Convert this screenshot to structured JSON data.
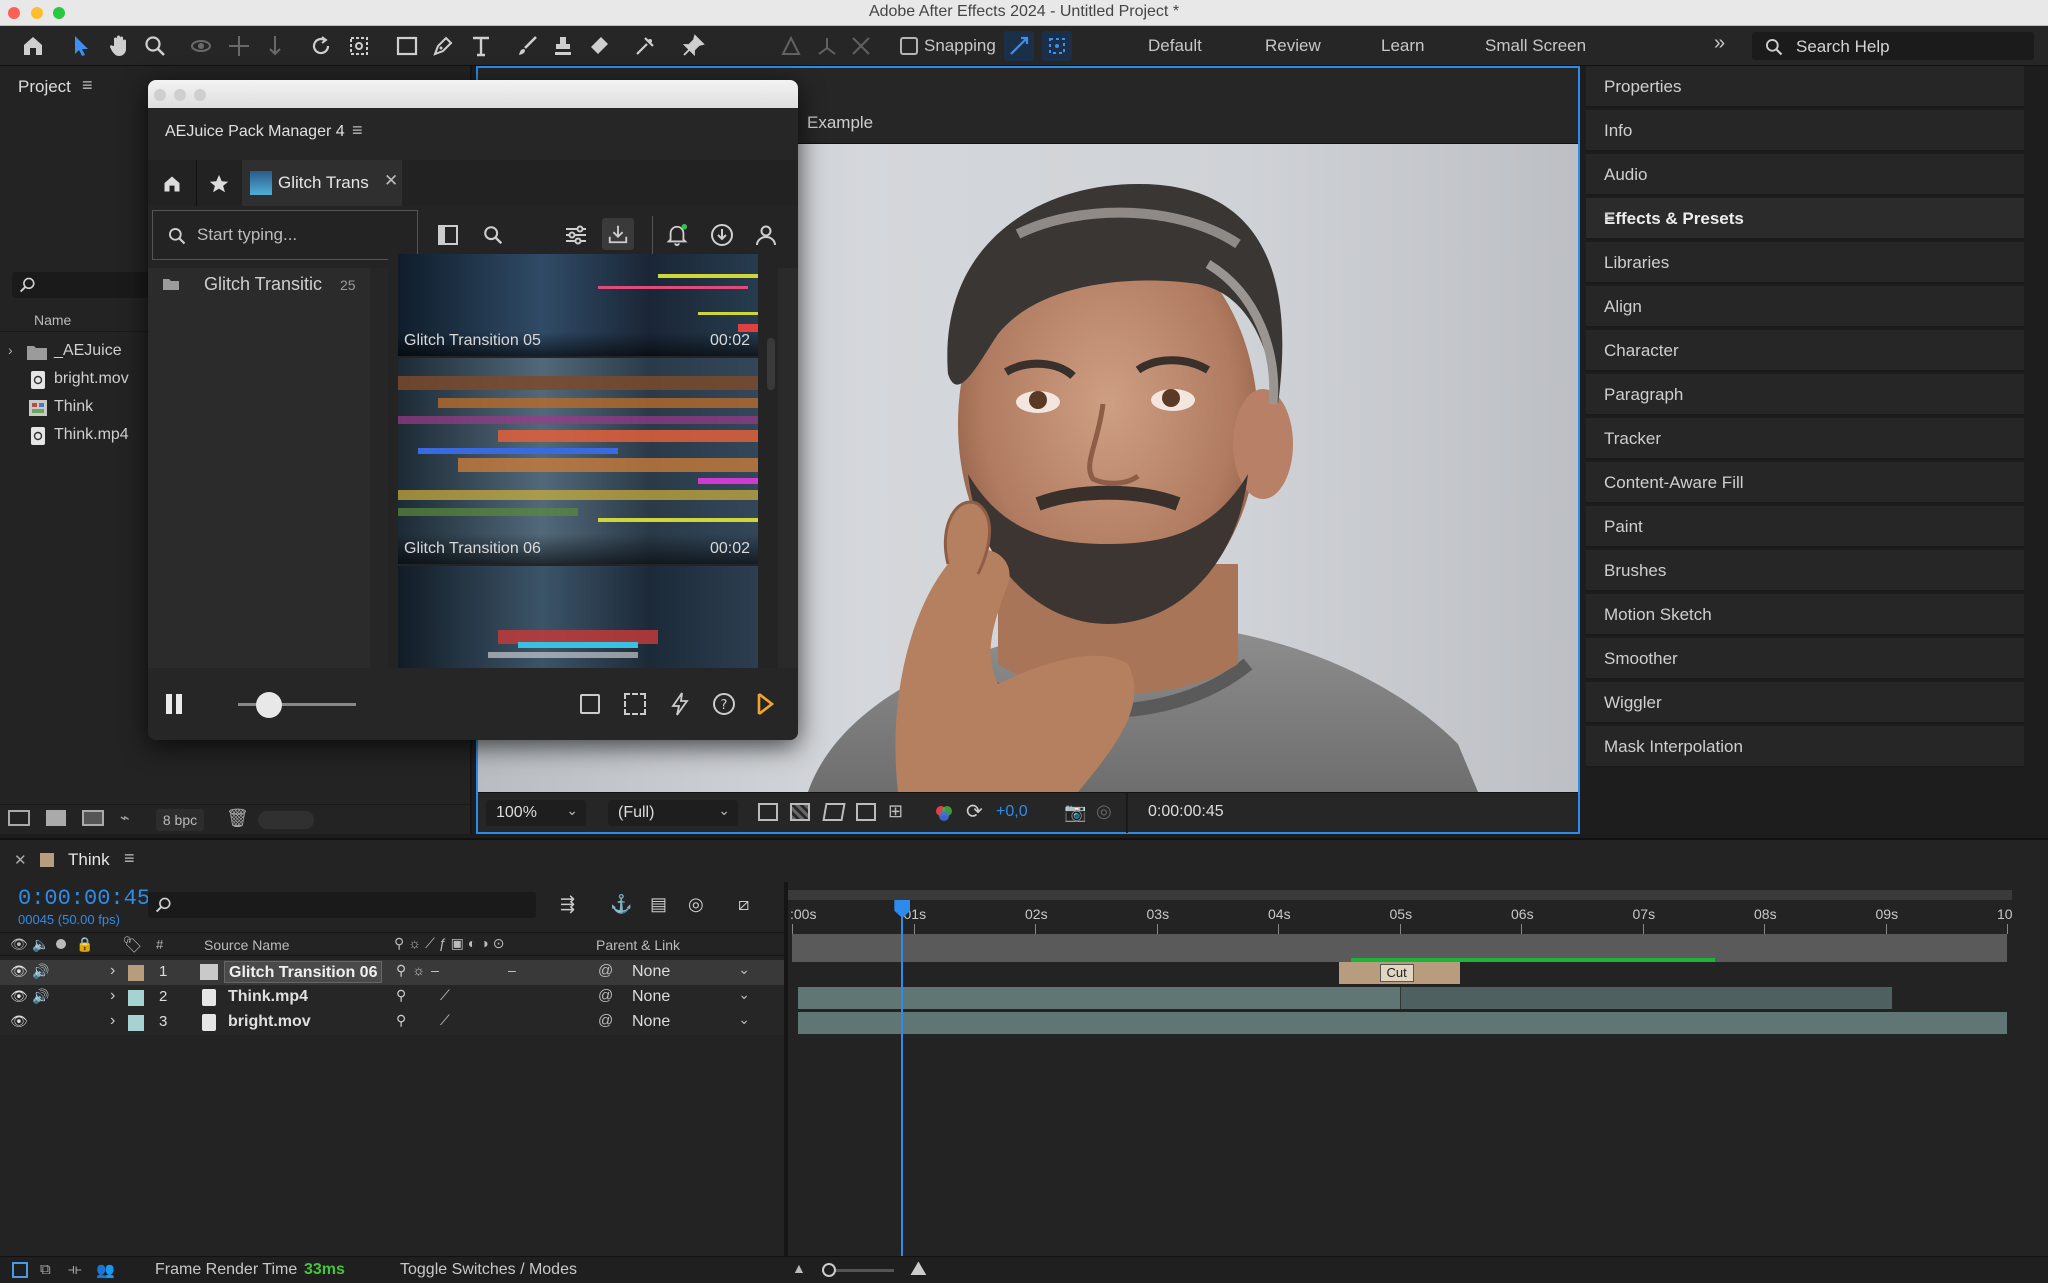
{
  "app": {
    "window_title": "Adobe After Effects 2024 - Untitled Project *"
  },
  "toolbar": {
    "snapping_label": "Snapping",
    "workspaces": [
      "Default",
      "Review",
      "Learn",
      "Small Screen"
    ],
    "search_help_placeholder": "Search Help"
  },
  "project_panel": {
    "title": "Project",
    "column_name": "Name",
    "items": [
      {
        "name": "_AEJuice",
        "type": "folder"
      },
      {
        "name": "bright.mov",
        "type": "footage"
      },
      {
        "name": "Think",
        "type": "composition"
      },
      {
        "name": "Think.mp4",
        "type": "footage"
      }
    ],
    "bpc": "8 bpc"
  },
  "aejuice": {
    "title": "AEJuice Pack Manager 4",
    "tab_label": "Glitch Trans",
    "search_placeholder": "Start typing...",
    "folder": {
      "name": "Glitch Transitic",
      "count": "25"
    },
    "thumbs": [
      {
        "label": "Glitch Transition 05",
        "duration": "00:02"
      },
      {
        "label": "Glitch Transition 06",
        "duration": "00:02"
      }
    ],
    "slider_value": 0.26
  },
  "composition": {
    "tab_fragment": "Example",
    "zoom": "100%",
    "resolution": "(Full)",
    "exposure": "+0,0",
    "timecode": "0:00:00:45"
  },
  "right_panel": {
    "items": [
      "Properties",
      "Info",
      "Audio",
      "Effects & Presets",
      "Libraries",
      "Align",
      "Character",
      "Paragraph",
      "Tracker",
      "Content-Aware Fill",
      "Paint",
      "Brushes",
      "Motion Sketch",
      "Smoother",
      "Wiggler",
      "Mask Interpolation"
    ]
  },
  "timeline": {
    "comp_name": "Think",
    "current_time": "0:00:00:45",
    "frame_info": "00045 (50.00 fps)",
    "columns": {
      "hash": "#",
      "source_name": "Source Name",
      "parent": "Parent & Link"
    },
    "ruler_labels": [
      ":00s",
      "01s",
      "02s",
      "03s",
      "04s",
      "05s",
      "06s",
      "07s",
      "08s",
      "09s",
      "10"
    ],
    "playhead_seconds": 0.9,
    "layers": [
      {
        "index": "1",
        "name": "Glitch Transition 06",
        "parent": "None",
        "label_color": "#b79c7d",
        "start": 4.5,
        "end": 5.5,
        "marker": "Cut"
      },
      {
        "index": "2",
        "name": "Think.mp4",
        "parent": "None",
        "label_color": "#a6d3d1",
        "start": 0.05,
        "end": 9.05,
        "split": 5.0
      },
      {
        "index": "3",
        "name": "bright.mov",
        "parent": "None",
        "label_color": "#a6d3d1",
        "start": 0.05,
        "end": 10.0
      }
    ],
    "work_area": {
      "start": 4.6,
      "end": 7.6
    }
  },
  "status": {
    "frame_render_label": "Frame Render Time",
    "frame_render_value": "33ms",
    "toggle_label": "Toggle Switches / Modes"
  },
  "colors": {
    "accent_blue": "#2d8ceb",
    "work_area_green": "#1db43a",
    "render_green": "#45c53a",
    "selected_label": "#b79c7d",
    "footage_label": "#a6d3d1"
  }
}
